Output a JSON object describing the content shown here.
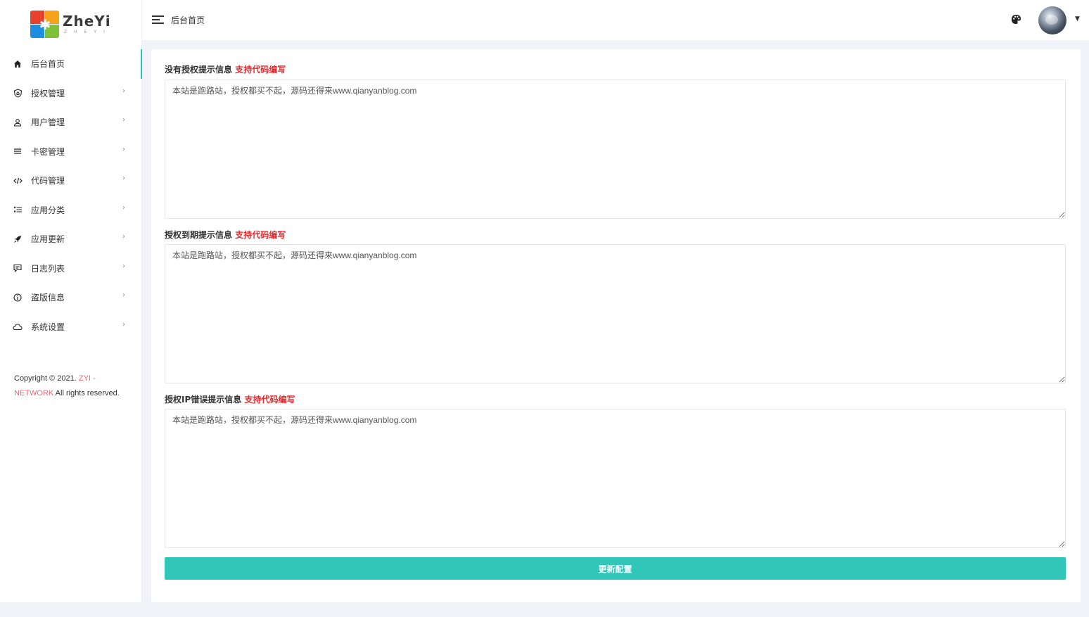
{
  "brand": {
    "title": "ZheYi",
    "subtitle": "ZHEYI"
  },
  "header": {
    "title": "后台首页"
  },
  "sidebar": {
    "items": [
      {
        "label": "后台首页",
        "icon": "home-icon",
        "active": true,
        "has_arrow": false
      },
      {
        "label": "授权管理",
        "icon": "shield-icon",
        "has_arrow": true
      },
      {
        "label": "用户管理",
        "icon": "user-icon",
        "has_arrow": true
      },
      {
        "label": "卡密管理",
        "icon": "list-icon",
        "has_arrow": true
      },
      {
        "label": "代码管理",
        "icon": "code-icon",
        "has_arrow": true
      },
      {
        "label": "应用分类",
        "icon": "category-icon",
        "has_arrow": true
      },
      {
        "label": "应用更新",
        "icon": "rocket-icon",
        "has_arrow": true
      },
      {
        "label": "日志列表",
        "icon": "message-icon",
        "has_arrow": true
      },
      {
        "label": "盗版信息",
        "icon": "info-icon",
        "has_arrow": true
      },
      {
        "label": "系统设置",
        "icon": "cloud-icon",
        "has_arrow": true
      }
    ],
    "arrow_glyph": "›"
  },
  "copyright": {
    "prefix": "Copyright © 2021. ",
    "brand": "ZYI - NETWORK",
    "suffix": " All rights reserved."
  },
  "form": {
    "fields": [
      {
        "label": "没有授权提示信息",
        "hint": "支持代码编写",
        "value": "本站是跑路站，授权都买不起，源码还得来www.qianyanblog.com"
      },
      {
        "label": "授权到期提示信息",
        "hint": "支持代码编写",
        "value": "本站是跑路站，授权都买不起，源码还得来www.qianyanblog.com"
      },
      {
        "label": "授权IP错误提示信息",
        "hint": "支持代码编写",
        "value": "本站是跑路站，授权都买不起，源码还得来www.qianyanblog.com"
      }
    ],
    "submit_label": "更新配置"
  },
  "colors": {
    "accent": "#30c6b8",
    "hint_red": "#e8282d",
    "copyright_accent": "#e96b7e"
  }
}
